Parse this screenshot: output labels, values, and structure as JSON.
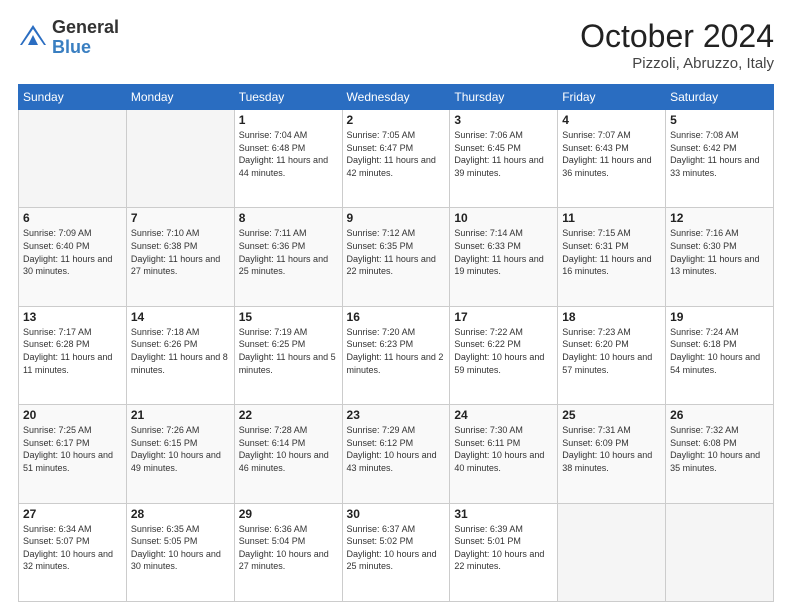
{
  "header": {
    "logo_general": "General",
    "logo_blue": "Blue",
    "title": "October 2024",
    "subtitle": "Pizzoli, Abruzzo, Italy"
  },
  "days_of_week": [
    "Sunday",
    "Monday",
    "Tuesday",
    "Wednesday",
    "Thursday",
    "Friday",
    "Saturday"
  ],
  "weeks": [
    [
      {
        "day": "",
        "info": ""
      },
      {
        "day": "",
        "info": ""
      },
      {
        "day": "1",
        "info": "Sunrise: 7:04 AM\nSunset: 6:48 PM\nDaylight: 11 hours and 44 minutes."
      },
      {
        "day": "2",
        "info": "Sunrise: 7:05 AM\nSunset: 6:47 PM\nDaylight: 11 hours and 42 minutes."
      },
      {
        "day": "3",
        "info": "Sunrise: 7:06 AM\nSunset: 6:45 PM\nDaylight: 11 hours and 39 minutes."
      },
      {
        "day": "4",
        "info": "Sunrise: 7:07 AM\nSunset: 6:43 PM\nDaylight: 11 hours and 36 minutes."
      },
      {
        "day": "5",
        "info": "Sunrise: 7:08 AM\nSunset: 6:42 PM\nDaylight: 11 hours and 33 minutes."
      }
    ],
    [
      {
        "day": "6",
        "info": "Sunrise: 7:09 AM\nSunset: 6:40 PM\nDaylight: 11 hours and 30 minutes."
      },
      {
        "day": "7",
        "info": "Sunrise: 7:10 AM\nSunset: 6:38 PM\nDaylight: 11 hours and 27 minutes."
      },
      {
        "day": "8",
        "info": "Sunrise: 7:11 AM\nSunset: 6:36 PM\nDaylight: 11 hours and 25 minutes."
      },
      {
        "day": "9",
        "info": "Sunrise: 7:12 AM\nSunset: 6:35 PM\nDaylight: 11 hours and 22 minutes."
      },
      {
        "day": "10",
        "info": "Sunrise: 7:14 AM\nSunset: 6:33 PM\nDaylight: 11 hours and 19 minutes."
      },
      {
        "day": "11",
        "info": "Sunrise: 7:15 AM\nSunset: 6:31 PM\nDaylight: 11 hours and 16 minutes."
      },
      {
        "day": "12",
        "info": "Sunrise: 7:16 AM\nSunset: 6:30 PM\nDaylight: 11 hours and 13 minutes."
      }
    ],
    [
      {
        "day": "13",
        "info": "Sunrise: 7:17 AM\nSunset: 6:28 PM\nDaylight: 11 hours and 11 minutes."
      },
      {
        "day": "14",
        "info": "Sunrise: 7:18 AM\nSunset: 6:26 PM\nDaylight: 11 hours and 8 minutes."
      },
      {
        "day": "15",
        "info": "Sunrise: 7:19 AM\nSunset: 6:25 PM\nDaylight: 11 hours and 5 minutes."
      },
      {
        "day": "16",
        "info": "Sunrise: 7:20 AM\nSunset: 6:23 PM\nDaylight: 11 hours and 2 minutes."
      },
      {
        "day": "17",
        "info": "Sunrise: 7:22 AM\nSunset: 6:22 PM\nDaylight: 10 hours and 59 minutes."
      },
      {
        "day": "18",
        "info": "Sunrise: 7:23 AM\nSunset: 6:20 PM\nDaylight: 10 hours and 57 minutes."
      },
      {
        "day": "19",
        "info": "Sunrise: 7:24 AM\nSunset: 6:18 PM\nDaylight: 10 hours and 54 minutes."
      }
    ],
    [
      {
        "day": "20",
        "info": "Sunrise: 7:25 AM\nSunset: 6:17 PM\nDaylight: 10 hours and 51 minutes."
      },
      {
        "day": "21",
        "info": "Sunrise: 7:26 AM\nSunset: 6:15 PM\nDaylight: 10 hours and 49 minutes."
      },
      {
        "day": "22",
        "info": "Sunrise: 7:28 AM\nSunset: 6:14 PM\nDaylight: 10 hours and 46 minutes."
      },
      {
        "day": "23",
        "info": "Sunrise: 7:29 AM\nSunset: 6:12 PM\nDaylight: 10 hours and 43 minutes."
      },
      {
        "day": "24",
        "info": "Sunrise: 7:30 AM\nSunset: 6:11 PM\nDaylight: 10 hours and 40 minutes."
      },
      {
        "day": "25",
        "info": "Sunrise: 7:31 AM\nSunset: 6:09 PM\nDaylight: 10 hours and 38 minutes."
      },
      {
        "day": "26",
        "info": "Sunrise: 7:32 AM\nSunset: 6:08 PM\nDaylight: 10 hours and 35 minutes."
      }
    ],
    [
      {
        "day": "27",
        "info": "Sunrise: 6:34 AM\nSunset: 5:07 PM\nDaylight: 10 hours and 32 minutes."
      },
      {
        "day": "28",
        "info": "Sunrise: 6:35 AM\nSunset: 5:05 PM\nDaylight: 10 hours and 30 minutes."
      },
      {
        "day": "29",
        "info": "Sunrise: 6:36 AM\nSunset: 5:04 PM\nDaylight: 10 hours and 27 minutes."
      },
      {
        "day": "30",
        "info": "Sunrise: 6:37 AM\nSunset: 5:02 PM\nDaylight: 10 hours and 25 minutes."
      },
      {
        "day": "31",
        "info": "Sunrise: 6:39 AM\nSunset: 5:01 PM\nDaylight: 10 hours and 22 minutes."
      },
      {
        "day": "",
        "info": ""
      },
      {
        "day": "",
        "info": ""
      }
    ]
  ]
}
